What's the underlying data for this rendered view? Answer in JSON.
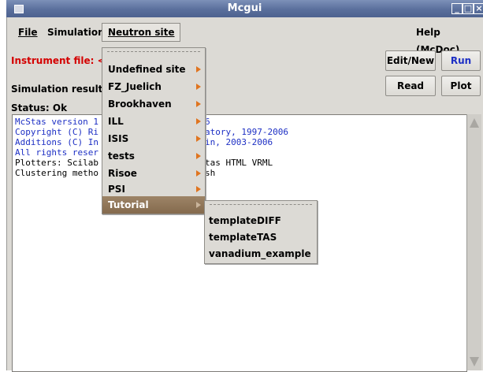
{
  "window": {
    "title": "Mcgui"
  },
  "menubar": {
    "file": "File",
    "simulation": "Simulation",
    "neutron_site": "Neutron site",
    "help": "Help (McDoc)"
  },
  "form": {
    "instrument_label": "Instrument file: <N",
    "results_label": "Simulation results:",
    "status_label": "Status: Ok"
  },
  "buttons": {
    "edit_new": "Edit/New",
    "run": "Run",
    "read": "Read",
    "plot": "Plot"
  },
  "console": {
    "lines_left": [
      "McStas version 1",
      "Copyright (C) Ri",
      "Additions (C) In",
      "All rights reser",
      "Plotters: Scilab",
      "Clustering metho"
    ],
    "lines_right": [
      "6",
      "atory, 1997-2006",
      "in, 2003-2006",
      "",
      "tas HTML VRML",
      "sh"
    ]
  },
  "neutron_site_menu": {
    "items": [
      {
        "label": "Undefined site"
      },
      {
        "label": "FZ_Juelich"
      },
      {
        "label": "Brookhaven"
      },
      {
        "label": "ILL"
      },
      {
        "label": "ISIS"
      },
      {
        "label": "tests"
      },
      {
        "label": "Risoe"
      },
      {
        "label": "PSI"
      },
      {
        "label": "Tutorial"
      }
    ],
    "selected": "Tutorial"
  },
  "tutorial_submenu": {
    "items": [
      "templateDIFF",
      "templateTAS",
      "vanadium_example"
    ]
  },
  "colors": {
    "titlebar": "#5a6f9c",
    "instrument_label": "#d40000",
    "run_button": "#1d2fc4",
    "console_blue": "#1d2fc4",
    "menu_highlight": "#8c7255",
    "submenu_arrow": "#e0741f"
  }
}
